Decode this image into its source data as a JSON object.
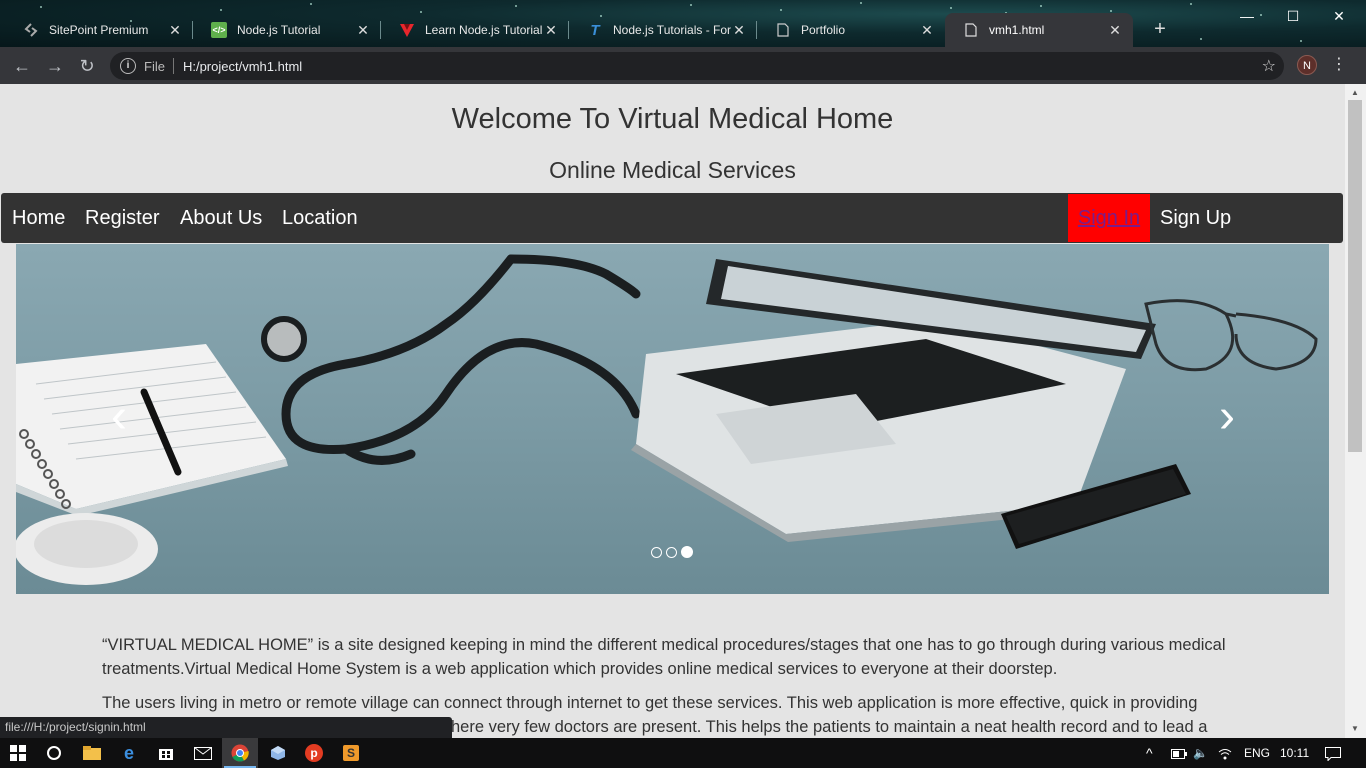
{
  "browser": {
    "tabs": [
      {
        "title": "SitePoint Premium",
        "icon": "sitepoint-icon"
      },
      {
        "title": "Node.js Tutorial",
        "icon": "nodejs-icon"
      },
      {
        "title": "Learn Node.js Tutorial",
        "icon": "vue-like-icon"
      },
      {
        "title": "Node.js Tutorials - For",
        "icon": "feather-icon"
      },
      {
        "title": "Portfolio",
        "icon": "page-icon"
      },
      {
        "title": "vmh1.html",
        "icon": "page-icon"
      }
    ],
    "active_tab": 5,
    "address": {
      "scheme": "File",
      "url": "H:/project/vmh1.html"
    },
    "profile_initial": "N"
  },
  "page": {
    "title": "Welcome To Virtual Medical Home",
    "subtitle": "Online Medical Services",
    "nav": {
      "left": [
        "Home",
        "Register",
        "About Us",
        "Location"
      ],
      "signin": "Sign In",
      "signup": "Sign Up"
    },
    "carousel": {
      "prev": "‹",
      "next": "›",
      "slide_count": 3,
      "active_slide": 3
    },
    "paragraphs": [
      "“VIRTUAL MEDICAL HOME” is a site designed keeping in mind the different medical procedures/stages that one has to go through during various medical treatments.Virtual Medical Home System is a web application which provides online medical services to everyone at their doorstep.",
      "The users living in metro or remote village can connect through internet to get these services. This web application is more effective, quick in providing ... where very few doctors are present. This helps the patients to maintain a neat health record and to lead a"
    ],
    "paragraph2_line1": "The users living in metro or remote village can connect through internet to get these services. This web application is more effective, quick in providing",
    "paragraph2_line2_visible": "here very few doctors are present. This helps the patients to maintain a neat health record and to lead a"
  },
  "status_bar": {
    "link": "file:///H:/project/signin.html"
  },
  "taskbar": {
    "lang": "ENG",
    "time": "10:11"
  }
}
